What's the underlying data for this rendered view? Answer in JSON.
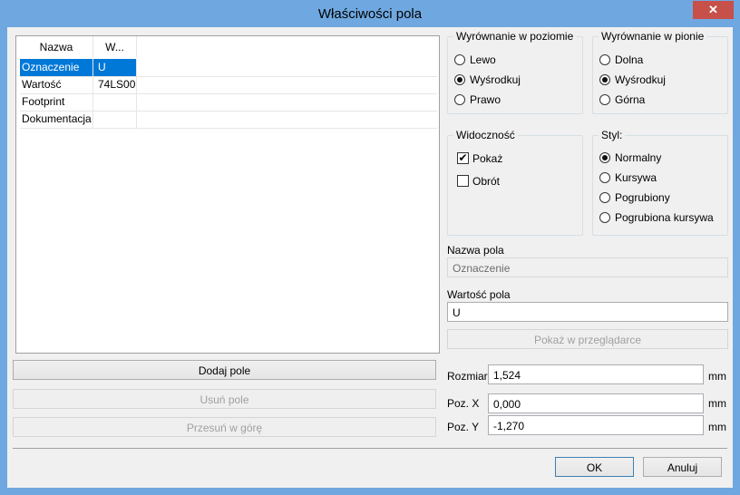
{
  "window": {
    "title": "Właściwości pola",
    "close_glyph": "✕"
  },
  "fields_table": {
    "columns": [
      "Nazwa",
      "W..."
    ],
    "rows": [
      {
        "name": "Oznaczenie",
        "value": "U"
      },
      {
        "name": "Wartość",
        "value": "74LS00"
      },
      {
        "name": "Footprint",
        "value": ""
      },
      {
        "name": "Dokumentacja",
        "value": ""
      }
    ],
    "selected_index": 0
  },
  "buttons": {
    "add": "Dodaj pole",
    "remove": "Usuń pole",
    "move_up": "Przesuń w górę",
    "browser": "Pokaż w przeglądarce",
    "ok": "OK",
    "cancel": "Anuluj"
  },
  "h_align": {
    "title": "Wyrównanie w poziomie",
    "options": [
      "Lewo",
      "Wyśrodkuj",
      "Prawo"
    ],
    "selected": 1
  },
  "v_align": {
    "title": "Wyrównanie w pionie",
    "options": [
      "Dolna",
      "Wyśrodkuj",
      "Górna"
    ],
    "selected": 1
  },
  "visibility": {
    "title": "Widoczność",
    "show": "Pokaż",
    "show_checked": true,
    "rotate": "Obrót",
    "rotate_checked": false,
    "check_glyph": "✔"
  },
  "style": {
    "title": "Styl:",
    "options": [
      "Normalny",
      "Kursywa",
      "Pogrubiony",
      "Pogrubiona kursywa"
    ],
    "selected": 0
  },
  "field_name": {
    "label": "Nazwa pola",
    "value": "Oznaczenie"
  },
  "field_value": {
    "label": "Wartość pola",
    "value": "U"
  },
  "size": {
    "label": "Rozmiar",
    "value": "1,524",
    "unit": "mm"
  },
  "pos_x": {
    "label": "Poz. X",
    "value": "0,000",
    "unit": "mm"
  },
  "pos_y": {
    "label": "Poz. Y",
    "value": "-1,270",
    "unit": "mm"
  },
  "colors": {
    "selection": "#0078d7",
    "titlebar": "#6fa8e0",
    "close": "#c7504a"
  }
}
